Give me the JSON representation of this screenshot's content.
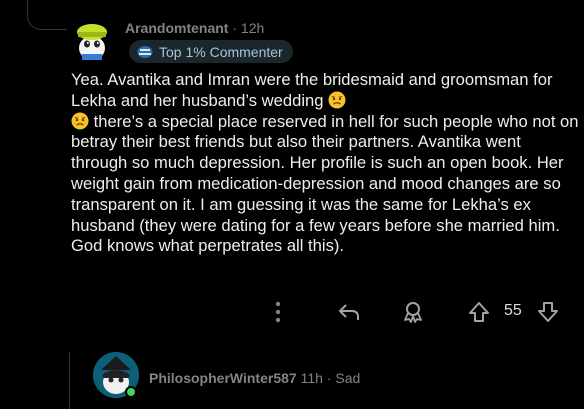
{
  "comment": {
    "username": "Arandomtenant",
    "separator": "·",
    "time": "12h",
    "badge_label": "Top 1% Commenter",
    "body_parts": [
      "Yea. Avantika and Imran were the bridesmaid and groomsman for Lekha and her husband’s wedding ",
      " there’s a special place reserved in hell for such people who not on betray their best friends but also their partners. Avantika went through so much depression. Her profile is such an open book. Her weight gain from medication-depression and mood changes are so transparent on it. I am guessing it was the same for Lekha’s ex husband (they were dating for a few years before she married him. God knows what perpetrates all this)."
    ],
    "score": "55",
    "icons": [
      "more-options-icon",
      "reply-icon",
      "award-icon",
      "upvote-icon",
      "downvote-icon"
    ]
  },
  "reply": {
    "username": "PhilosopherWinter587",
    "time": "11h",
    "separator": "·",
    "status": "Sad"
  },
  "colors": {
    "background": "#000000",
    "text": "#eeeeee",
    "muted": "#818384",
    "badge_bg": "#1a282d",
    "online": "#46d160"
  }
}
